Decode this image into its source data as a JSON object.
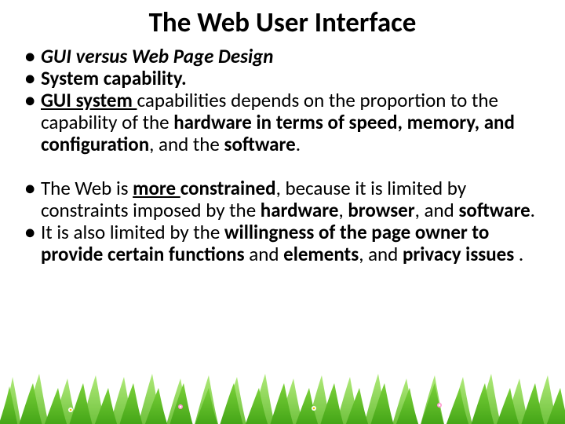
{
  "title": "The Web User Interface",
  "bullets": {
    "b1": {
      "t1": "GUI versus Web Page Design"
    },
    "b2": {
      "t1": "System capability."
    },
    "b3": {
      "t1": "GUI system ",
      "t2": "capabilities depends on the  proportion to the capability of the ",
      "t3": "hardware in terms of speed, memory, and configuration",
      "t4": ", and the  ",
      "t5": "software",
      "t6": "."
    },
    "b4": {
      "t1": "The Web is ",
      "t2": "more ",
      "t3": "constrained",
      "t4": ", because it is limited by constraints imposed by the ",
      "t5": "hardware",
      "t6": ", ",
      "t7": "browser",
      "t8": ", and ",
      "t9": "software",
      "t10": "."
    },
    "b5": {
      "t1": "It is also limited by the ",
      "t2": "willingness of the page owner to provide certain functions ",
      "t3": "and ",
      "t4": "elements",
      "t5": ", and ",
      "t6": "privacy issues ",
      "t7": "."
    }
  }
}
